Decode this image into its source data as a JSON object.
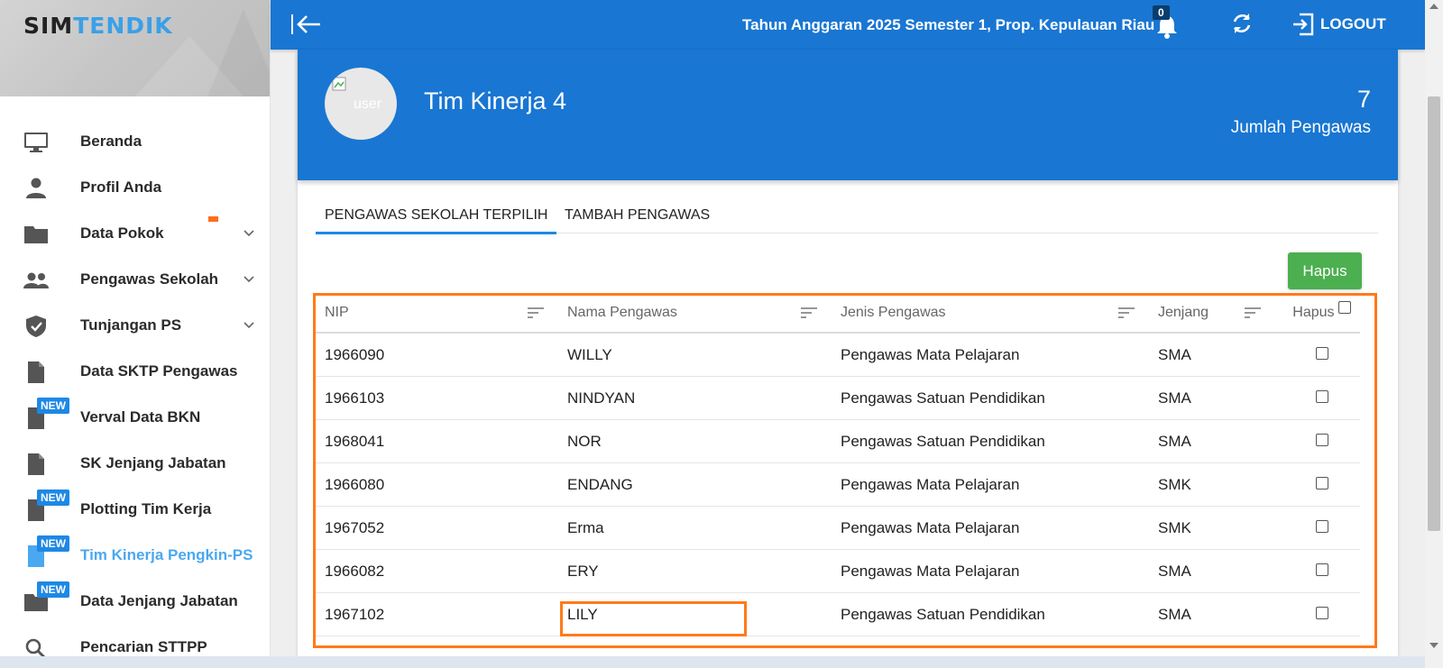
{
  "brand": {
    "part1": "SIM",
    "part2": "TENDIK"
  },
  "sidebar": {
    "items": [
      {
        "label": "Beranda",
        "icon": "monitor-icon"
      },
      {
        "label": "Profil Anda",
        "icon": "person-icon"
      },
      {
        "label": "Data Pokok",
        "icon": "folder-icon"
      },
      {
        "label": "Pengawas Sekolah",
        "icon": "group-icon"
      },
      {
        "label": "Tunjangan PS",
        "icon": "shield-check-icon"
      },
      {
        "label": "Data SKTP Pengawas",
        "icon": "document-icon"
      },
      {
        "label": "Verval Data BKN",
        "icon": "document-icon",
        "badge": "NEW"
      },
      {
        "label": "SK Jenjang Jabatan",
        "icon": "document-icon"
      },
      {
        "label": "Plotting Tim Kerja",
        "icon": "document-icon",
        "badge": "NEW"
      },
      {
        "label": "Tim Kinerja Pengkin-PS",
        "icon": "document-icon",
        "badge": "NEW",
        "active": true
      },
      {
        "label": "Data Jenjang Jabatan",
        "icon": "folder-icon",
        "badge": "NEW"
      },
      {
        "label": "Pencarian STTPP",
        "icon": "search-icon"
      }
    ]
  },
  "header": {
    "context": "Tahun Anggaran 2025 Semester 1, Prop. Kepulauan Riau",
    "notif_count": "0",
    "logout_label": "LOGOUT"
  },
  "profile": {
    "avatar_alt": "user",
    "team_name": "Tim Kinerja 4",
    "count": "7",
    "count_label": "Jumlah Pengawas"
  },
  "tabs": {
    "selected": "PENGAWAS SEKOLAH TERPILIH",
    "add": "TAMBAH PENGAWAS"
  },
  "actions": {
    "delete_label": "Hapus"
  },
  "table": {
    "headers": {
      "nip": "NIP",
      "nama": "Nama Pengawas",
      "jenis": "Jenis Pengawas",
      "jenjang": "Jenjang",
      "hapus": "Hapus"
    },
    "rows": [
      {
        "nip": "1966090",
        "nama": "WILLY",
        "jenis": "Pengawas Mata Pelajaran",
        "jenjang": "SMA"
      },
      {
        "nip": "1966103",
        "nama": "NINDYAN",
        "jenis": "Pengawas Satuan Pendidikan",
        "jenjang": "SMA"
      },
      {
        "nip": "1968041",
        "nama": "NOR",
        "jenis": "Pengawas Satuan Pendidikan",
        "jenjang": "SMA"
      },
      {
        "nip": "1966080",
        "nama": "ENDANG",
        "jenis": "Pengawas Mata Pelajaran",
        "jenjang": "SMK"
      },
      {
        "nip": "1967052",
        "nama": "Erma",
        "jenis": "Pengawas Mata Pelajaran",
        "jenjang": "SMK"
      },
      {
        "nip": "1966082",
        "nama": "ERY",
        "jenis": "Pengawas Mata Pelajaran",
        "jenjang": "SMA"
      },
      {
        "nip": "1967102",
        "nama": "LILY",
        "jenis": "Pengawas Satuan Pendidikan",
        "jenjang": "SMA"
      }
    ]
  },
  "colors": {
    "primary": "#1976d2",
    "accent_green": "#4caf50",
    "highlight": "#ff7a1a",
    "new_badge": "#1e88e5",
    "brand_blue": "#3aa0e8"
  }
}
